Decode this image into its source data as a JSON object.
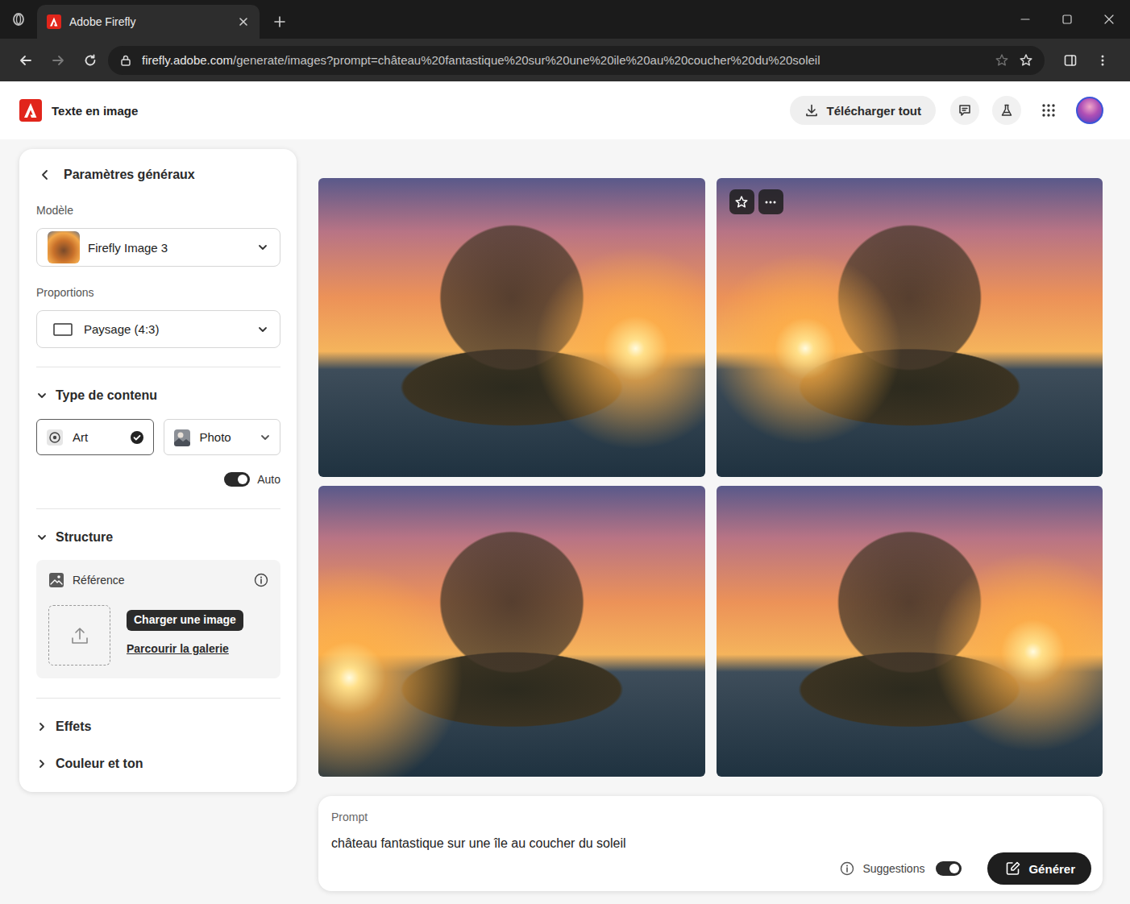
{
  "tabs": [
    {
      "label": "Adobe Firefly",
      "selected": true
    }
  ],
  "address_bar": {
    "host": "firefly.adobe.com",
    "path": "/generate/images?prompt=château%20fantastique%20sur%20une%20ile%20au%20coucher%20du%20soleil"
  },
  "header": {
    "app_title": "Texte en image",
    "download_button": "Télécharger tout"
  },
  "sidebar": {
    "heading": "Paramètres généraux",
    "model": {
      "label": "Modèle",
      "value": "Firefly Image 3"
    },
    "proportions": {
      "label": "Proportions",
      "value": "Paysage (4:3)"
    },
    "content_type": {
      "title": "Type de contenu",
      "expanded": true,
      "options": [
        {
          "label": "Art",
          "selected": true
        },
        {
          "label": "Photo",
          "selected": false
        }
      ],
      "auto": {
        "label": "Auto",
        "on": true
      }
    },
    "structure": {
      "title": "Structure",
      "expanded": true,
      "reference": {
        "title": "Référence",
        "upload_button": "Charger une image",
        "gallery_link": "Parcourir la galerie"
      }
    },
    "collapsed_sections": [
      {
        "title": "Effets",
        "expanded": false
      },
      {
        "title": "Couleur et ton",
        "expanded": false
      }
    ]
  },
  "images": [
    {
      "hovered": false
    },
    {
      "hovered": true
    },
    {
      "hovered": false
    },
    {
      "hovered": false
    }
  ],
  "prompt": {
    "label": "Prompt",
    "text": "château fantastique sur une île au coucher du soleil",
    "suggestions": {
      "label": "Suggestions",
      "on": true
    },
    "generate_button": "Générer"
  }
}
